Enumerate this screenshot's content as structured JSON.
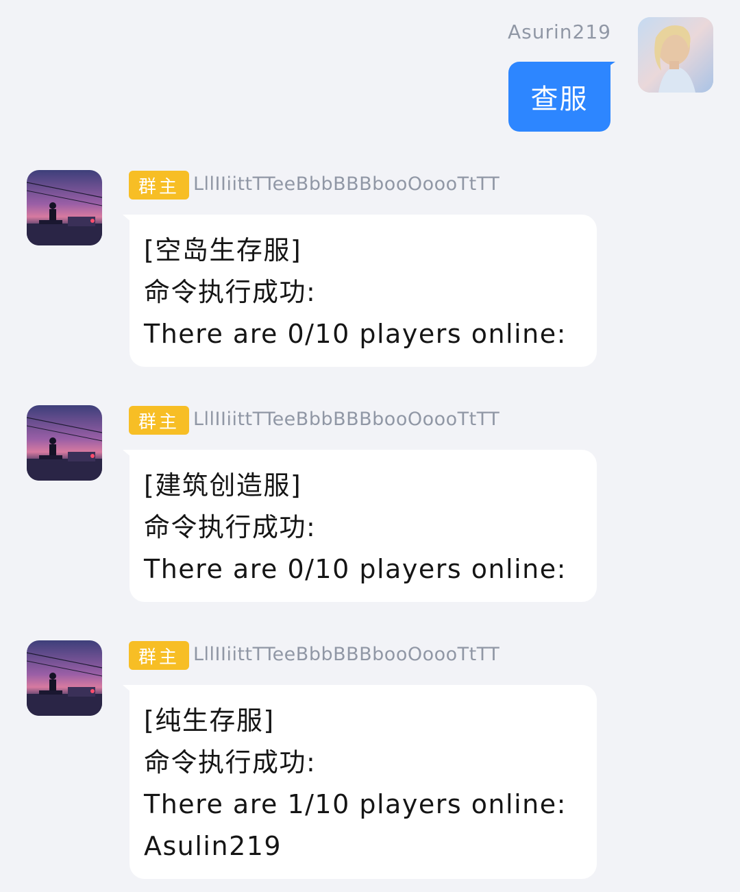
{
  "outgoing": {
    "sender": "Asurin219",
    "text": "查服"
  },
  "incoming": [
    {
      "badge": "群主",
      "sender": "LllIIiittTTeeBbbBBBbooOoooTtTT",
      "lines": [
        "[空岛生存服]",
        "命令执行成功:",
        "There are 0/10 players online:"
      ]
    },
    {
      "badge": "群主",
      "sender": "LllIIiittTTeeBbbBBBbooOoooTtTT",
      "lines": [
        "[建筑创造服]",
        "命令执行成功:",
        "There are 0/10 players online:"
      ]
    },
    {
      "badge": "群主",
      "sender": "LllIIiittTTeeBbbBBBbooOoooTtTT",
      "lines": [
        "[纯生存服]",
        "命令执行成功:",
        "There are 1/10 players online:",
        "Asulin219"
      ]
    }
  ],
  "colors": {
    "background": "#f2f3f7",
    "outgoing_bubble": "#2d86ff",
    "badge": "#f7be25",
    "name_text": "#9097a5"
  },
  "icons": {
    "outgoing_avatar": "user-avatar-photo",
    "incoming_avatar": "anime-sunset-avatar"
  }
}
